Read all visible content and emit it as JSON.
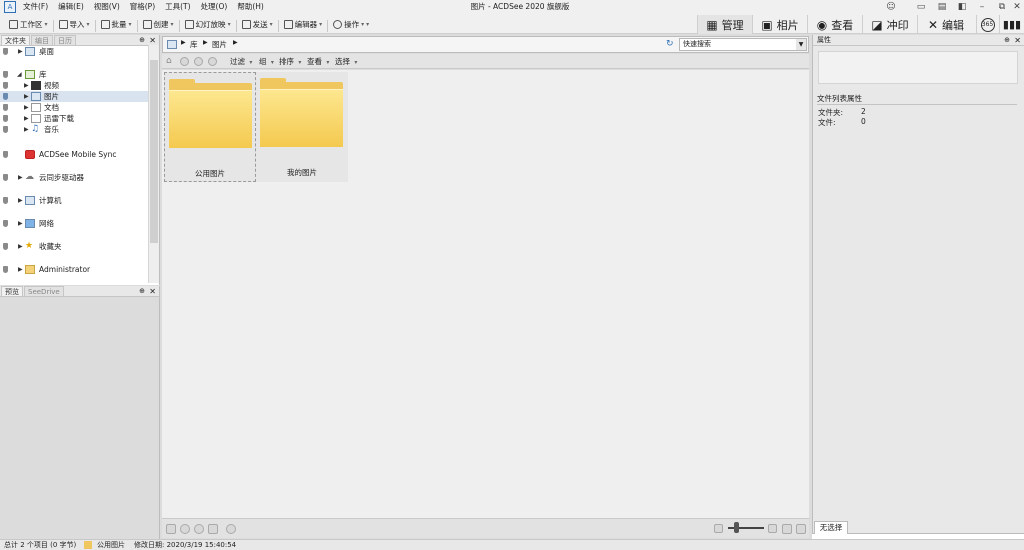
{
  "app": {
    "title": "图片 - ACDSee 2020 旗舰版",
    "icon_label": "A",
    "window_controls": [
      "user-icon",
      "minimize-icon",
      "restore-icon",
      "close-icon"
    ]
  },
  "menu": [
    "文件(F)",
    "编辑(E)",
    "视图(V)",
    "窗格(P)",
    "工具(T)",
    "处理(O)",
    "帮助(H)"
  ],
  "toolbar": {
    "items": [
      {
        "label": "工作区",
        "icon": "workspace-icon"
      },
      {
        "label": "导入",
        "icon": "import-icon"
      },
      {
        "label": "批量",
        "icon": "batch-icon"
      },
      {
        "label": "创建",
        "icon": "create-icon"
      },
      {
        "label": "幻灯放映",
        "icon": "slideshow-icon"
      },
      {
        "label": "发送",
        "icon": "send-icon"
      },
      {
        "label": "编辑器",
        "icon": "editor-icon"
      },
      {
        "label": "操作",
        "icon": "action-icon"
      }
    ]
  },
  "modes": [
    {
      "label": "管理",
      "icon": "grid-icon",
      "active": true
    },
    {
      "label": "相片",
      "icon": "photo-icon",
      "active": false
    },
    {
      "label": "查看",
      "icon": "eye-icon",
      "active": false
    },
    {
      "label": "冲印",
      "icon": "develop-icon",
      "active": false
    },
    {
      "label": "编辑",
      "icon": "edit-tools-icon",
      "active": false
    }
  ],
  "folder_panel": {
    "tabs": [
      "文件夹",
      "编目",
      "日历"
    ],
    "items": [
      {
        "label": "桌面",
        "indent": 0
      },
      {
        "label": "库",
        "indent": 0
      },
      {
        "label": "视频",
        "indent": 1
      },
      {
        "label": "图片",
        "indent": 1,
        "selected": true
      },
      {
        "label": "文档",
        "indent": 1
      },
      {
        "label": "迅雷下载",
        "indent": 1
      },
      {
        "label": "音乐",
        "indent": 1
      },
      {
        "label": "ACDSee Mobile Sync",
        "indent": 0
      },
      {
        "label": "云同步驱动器",
        "indent": 0
      },
      {
        "label": "计算机",
        "indent": 0
      },
      {
        "label": "网络",
        "indent": 0
      },
      {
        "label": "收藏夹",
        "indent": 0
      },
      {
        "label": "Administrator",
        "indent": 0
      }
    ]
  },
  "preview_panel": {
    "tabs": [
      "预览",
      "SeeDrive"
    ]
  },
  "address_bar": {
    "crumbs": [
      "库",
      "图片"
    ],
    "search_placeholder": "快速搜索"
  },
  "filter_bar": [
    "过滤",
    "组",
    "排序",
    "查看",
    "选择"
  ],
  "files": [
    {
      "name": "公用图片",
      "focused": true
    },
    {
      "name": "我的图片",
      "focused": false
    }
  ],
  "properties": {
    "header": "属性",
    "section_title": "文件列表属性",
    "rows": [
      {
        "key": "文件夹:",
        "value": "2"
      },
      {
        "key": "文件:",
        "value": "0"
      }
    ],
    "bottom_tab": "无选择"
  },
  "status": {
    "summary": "总计 2 个项目 (0 字节)",
    "current": "公用图片",
    "modified": "修改日期: 2020/3/19 15:40:54"
  },
  "colors": {
    "accent": "#2f6fb5",
    "folder": "#f4c94f",
    "selection": "#d9e3f0"
  }
}
